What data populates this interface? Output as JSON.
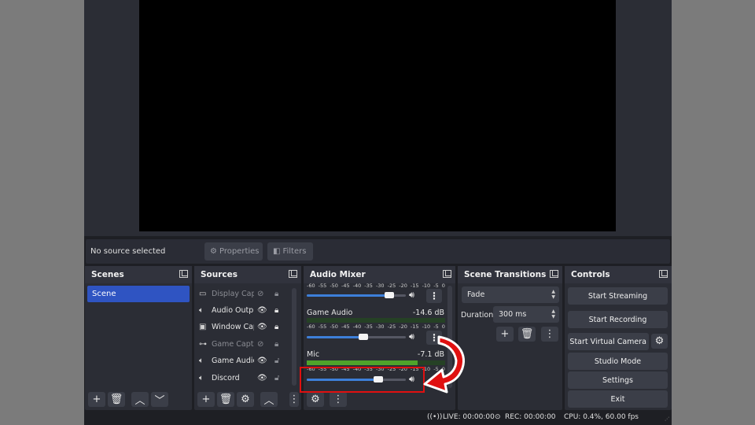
{
  "context_bar": {
    "status": "No source selected",
    "properties_label": "Properties",
    "filters_label": "Filters"
  },
  "scenes": {
    "title": "Scenes",
    "items": [
      "Scene"
    ]
  },
  "sources": {
    "title": "Sources",
    "items": [
      {
        "name": "Display Capt",
        "icon": "monitor-icon",
        "visible": false,
        "locked": true
      },
      {
        "name": "Audio Outpu",
        "icon": "speaker-icon",
        "visible": true,
        "locked": true
      },
      {
        "name": "Window Cap",
        "icon": "window-icon",
        "visible": true,
        "locked": true
      },
      {
        "name": "Game Captu",
        "icon": "gamepad-icon",
        "visible": false,
        "locked": true
      },
      {
        "name": "Game Audio",
        "icon": "speaker-icon",
        "visible": true,
        "locked": false
      },
      {
        "name": "Discord",
        "icon": "speaker-icon",
        "visible": true,
        "locked": false
      }
    ]
  },
  "audio_mixer": {
    "title": "Audio Mixer",
    "scale_labels": [
      "-60",
      "-55",
      "-50",
      "-45",
      "-40",
      "-35",
      "-30",
      "-25",
      "-20",
      "-15",
      "-10",
      "-5",
      "0"
    ],
    "channels": [
      {
        "name": "",
        "db": "",
        "volume": 0.83,
        "level": 0.0
      },
      {
        "name": "Game Audio",
        "db": "-14.6 dB",
        "volume": 0.57,
        "level": 0.0
      },
      {
        "name": "Mic",
        "db": "-7.1 dB",
        "volume": 0.72,
        "level": 0.8
      }
    ]
  },
  "scene_transitions": {
    "title": "Scene Transitions",
    "transition": "Fade",
    "duration_label": "Duration",
    "duration": "300 ms"
  },
  "controls": {
    "title": "Controls",
    "start_streaming": "Start Streaming",
    "start_recording": "Start Recording",
    "start_virtual_camera": "Start Virtual Camera",
    "studio_mode": "Studio Mode",
    "settings": "Settings",
    "exit": "Exit"
  },
  "status_bar": {
    "live": "LIVE: 00:00:00",
    "rec": "REC: 00:00:00",
    "cpu": "CPU: 0.4%, 60.00 fps"
  },
  "colors": {
    "accent": "#2f54c2",
    "highlight": "#e01010",
    "meter_green": "#4fa32a"
  }
}
